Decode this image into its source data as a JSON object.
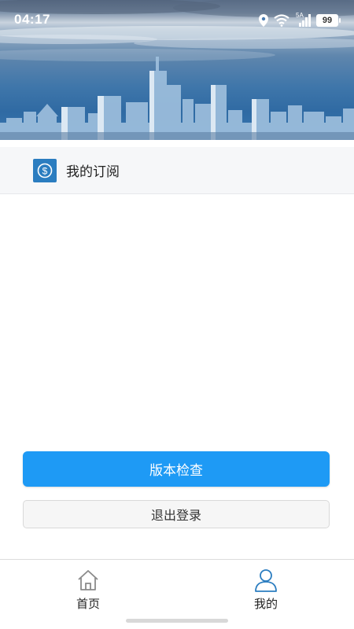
{
  "status_bar": {
    "time": "04:17",
    "network_label": "5A",
    "battery_level": "99",
    "icons": [
      "location-icon",
      "wifi-icon",
      "cellular-signal-icon",
      "battery-icon"
    ]
  },
  "subscription": {
    "label": "我的订阅",
    "icon": "dollar-coin-icon"
  },
  "actions": {
    "version_check_label": "版本检查",
    "logout_label": "退出登录"
  },
  "bottom_nav": {
    "items": [
      {
        "label": "首页",
        "icon": "home-icon"
      },
      {
        "label": "我的",
        "icon": "user-profile-icon",
        "active": true
      }
    ]
  },
  "colors": {
    "primary_button": "#1e9af5",
    "active_tab_icon": "#2b7dc0",
    "subscription_icon_bg": "#2b7dc0"
  }
}
